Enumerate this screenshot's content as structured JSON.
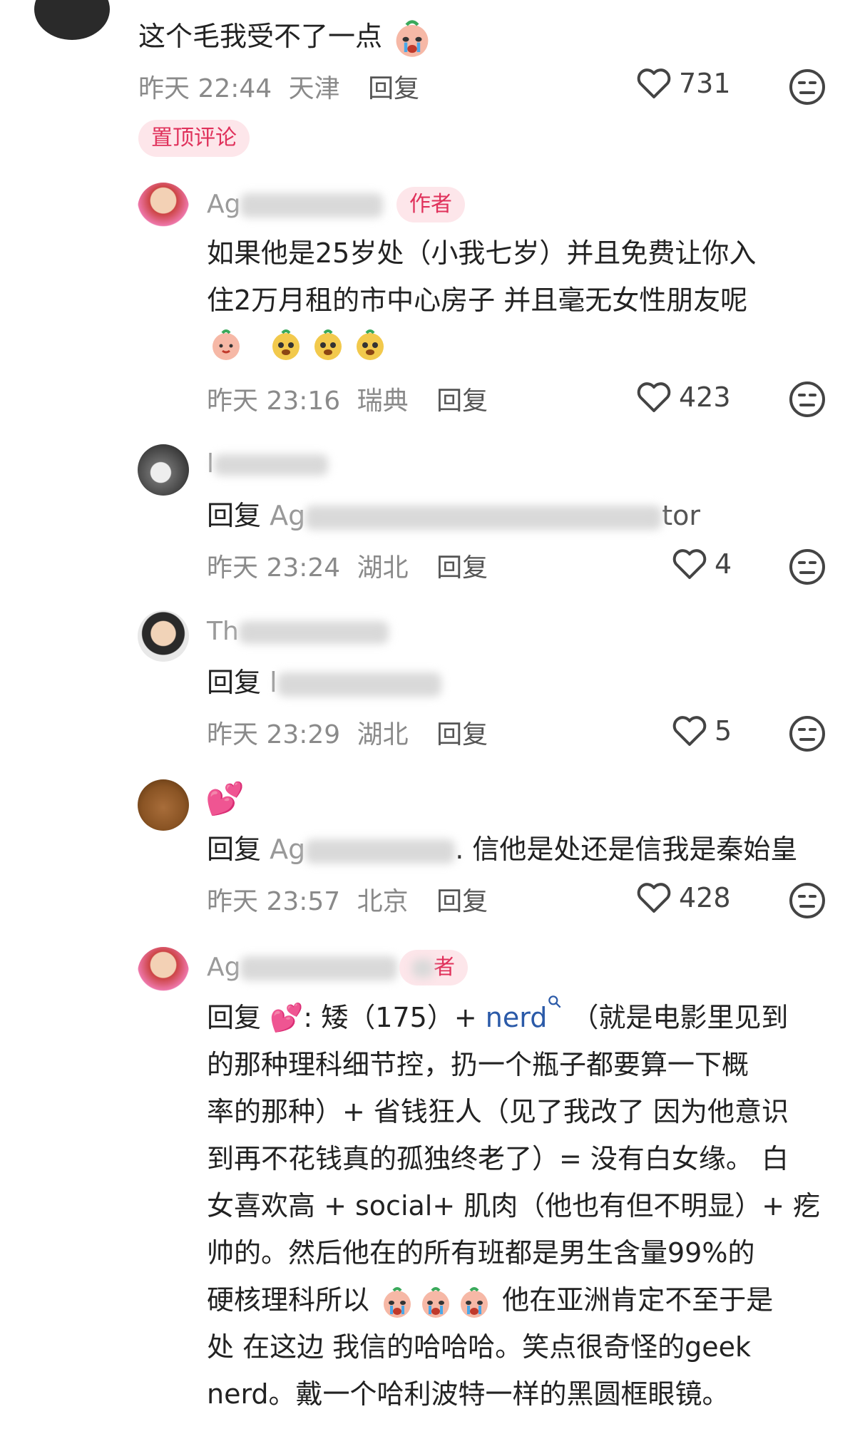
{
  "top_comment": {
    "text": "这个毛我受不了一点",
    "time": "昨天 22:44",
    "location": "天津",
    "reply_label": "回复",
    "likes": "731",
    "pinned_label": "置顶评论"
  },
  "replies": [
    {
      "name_visible": "Ag",
      "author_tag": "作者",
      "lines": [
        "如果他是25岁处（小我七岁）并且免费让你入",
        "住2万月租的市中心房子 并且毫无女性朋友呢"
      ],
      "time": "昨天 23:16",
      "location": "瑞典",
      "reply_label": "回复",
      "likes": "423"
    },
    {
      "name_visible": "l",
      "reply_prefix": "回复",
      "mention_visible": "Ag",
      "mention_tail": "tor",
      "time": "昨天 23:24",
      "location": "湖北",
      "reply_label": "回复",
      "likes": "4"
    },
    {
      "name_visible": "Th",
      "reply_prefix": "回复",
      "mention_visible": "l",
      "time": "昨天 23:29",
      "location": "湖北",
      "reply_label": "回复",
      "likes": "5"
    },
    {
      "name_emoji": "💕",
      "reply_prefix": "回复",
      "mention_visible": "Ag",
      "text": ". 信他是处还是信我是秦始皇",
      "time": "昨天 23:57",
      "location": "北京",
      "reply_label": "回复",
      "likes": "428"
    },
    {
      "name_visible": "Ag",
      "author_tag": "者",
      "reply_prefix": "回复",
      "line1_a": "💕: 矮（175）+",
      "line1_nerd": "nerd",
      "line1_b": "（就是电影里见到",
      "lines": [
        "的那种理科细节控，扔一个瓶子都要算一下概",
        "率的那种）+ 省钱狂人（见了我改了 因为他意识",
        "到再不花钱真的孤独终老了）= 没有白女缘。 白",
        "女喜欢高 + social+ 肌肉（他也有但不明显）+ 疙",
        "帅的。然后他在的所有班都是男生含量99%的"
      ],
      "line7_a": "硬核理科所以",
      "line7_b": "他在亚洲肯定不至于是",
      "lines_end": [
        "处 在这边 我信的哈哈哈。笑点很奇怪的geek",
        "nerd。戴一个哈利波特一样的黑圆框眼镜。"
      ]
    }
  ],
  "colors": {
    "accent": "#e0315b",
    "tag_bg": "#fde6ea",
    "meta_text": "#8a8a8a",
    "link": "#2b5aa8"
  }
}
